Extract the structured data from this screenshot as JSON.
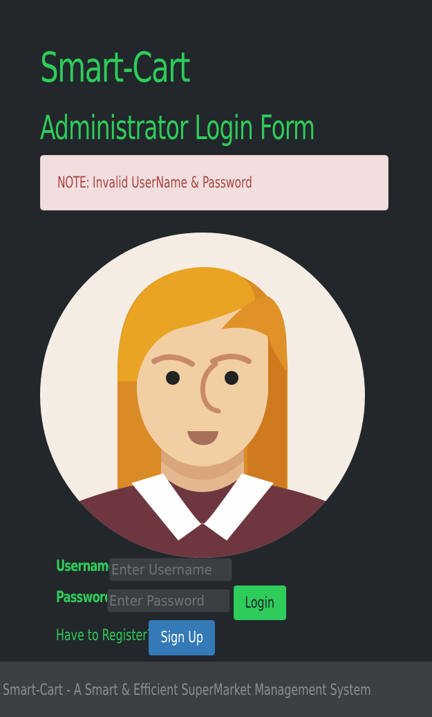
{
  "header": {
    "app_title": "Smart-Cart",
    "form_title": "Administrator Login Form"
  },
  "alert": {
    "strong": "NOTE:",
    "message": "Invalid UserName & Password"
  },
  "avatar": {
    "icon": "female-user-avatar-icon"
  },
  "form": {
    "username_label": "Username",
    "username_placeholder": "Enter Username",
    "username_value": "",
    "password_label": "Password",
    "password_placeholder": "Enter Password",
    "password_value": "",
    "login_label": "Login",
    "register_prompt": "Have to Register?",
    "signup_label": "Sign Up"
  },
  "footer": {
    "text": "Smart-Cart - A Smart & Efficient SuperMarket Management System"
  },
  "colors": {
    "background": "#22272b",
    "accent_green": "#2ecc5a",
    "alert_bg": "#f2dede",
    "alert_text": "#a94442",
    "signup_blue": "#337ab7",
    "footer_bg": "#3c4045"
  }
}
